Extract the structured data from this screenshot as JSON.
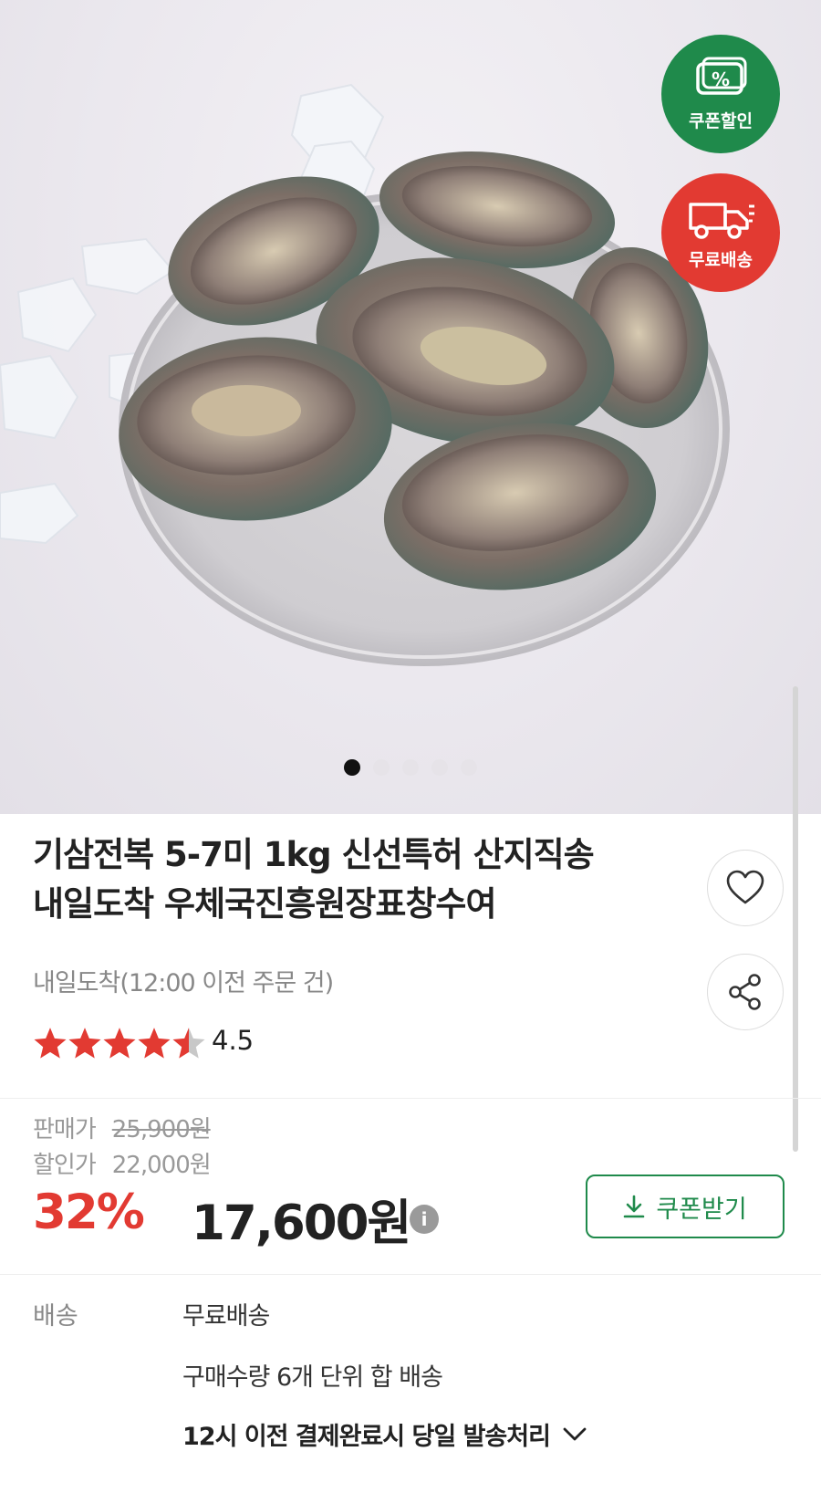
{
  "badges": {
    "coupon": "쿠폰할인",
    "free_shipping": "무료배송"
  },
  "gallery": {
    "total": 5,
    "active_index": 0
  },
  "product": {
    "title_line1": "기삼전복 5-7미 1kg 신선특허 산지직송",
    "title_line2": "내일도착 우체국진흥원장표창수여",
    "delivery_subtitle": "내일도착(12:00 이전 주문 건)",
    "rating": "4.5",
    "rating_value": 4.5,
    "rating_max": 5
  },
  "pricing": {
    "sale_label": "판매가",
    "sale_price": "25,900원",
    "discount_label": "할인가",
    "discount_price": "22,000원",
    "percent": "32%",
    "final_price": "17,600원",
    "info_symbol": "i",
    "coupon_button": "쿠폰받기"
  },
  "shipping": {
    "label": "배송",
    "type": "무료배송",
    "bundle": "구매수량 6개 단위 합 배송",
    "dispatch": "12시 이전 결제완료시 당일 발송처리"
  },
  "colors": {
    "green": "#1f8a4b",
    "red": "#e23a32",
    "star": "#e23a32"
  },
  "icons": {
    "wishlist": "heart-icon",
    "share": "share-icon",
    "download": "download-icon",
    "expand": "chevron-down-icon"
  }
}
